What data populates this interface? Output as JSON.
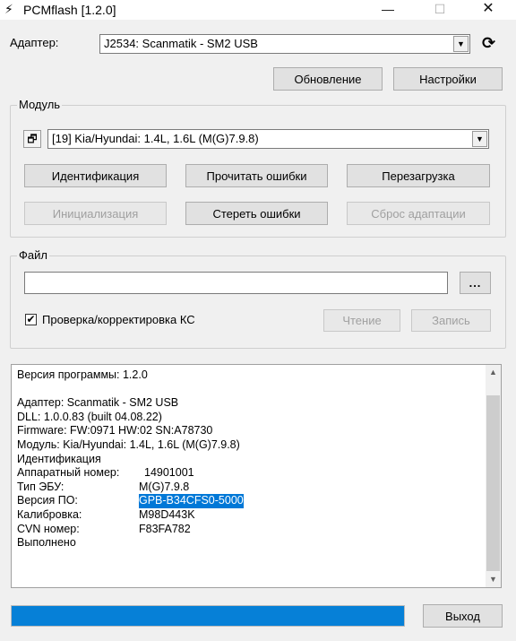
{
  "window": {
    "title": "PCMflash [1.2.0]",
    "minimize_glyph": "—",
    "maximize_glyph": "☐",
    "close_glyph": "✕"
  },
  "adapter": {
    "label": "Адаптер:",
    "selected": "J2534: Scanmatik - SM2 USB",
    "refresh_label": "Обновление",
    "settings_label": "Настройки"
  },
  "module_group": {
    "title": "Модуль",
    "selected": "[19] Kia/Hyundai: 1.4L, 1.6L (M(G)7.9.8)",
    "buttons": {
      "identify": "Идентификация",
      "read_errors": "Прочитать ошибки",
      "reboot": "Перезагрузка",
      "init": "Инициализация",
      "clear_errors": "Стереть ошибки",
      "reset_adaptation": "Сброс адаптации"
    }
  },
  "file_group": {
    "title": "Файл",
    "path_value": "",
    "browse_label": "...",
    "checksum_label": "Проверка/корректировка КС",
    "checksum_checked": true,
    "read_label": "Чтение",
    "write_label": "Запись"
  },
  "log": {
    "lines": [
      {
        "k": "Версия программы: 1.2.0",
        "v": ""
      },
      {
        "k": "",
        "v": ""
      },
      {
        "k": "Адаптер: Scanmatik - SM2 USB",
        "v": ""
      },
      {
        "k": "DLL: 1.0.0.83 (built 04.08.22)",
        "v": ""
      },
      {
        "k": "Firmware: FW:0971 HW:02 SN:A78730",
        "v": ""
      },
      {
        "k": "Модуль: Kia/Hyundai: 1.4L, 1.6L (M(G)7.9.8)",
        "v": ""
      },
      {
        "k": "Идентификация",
        "v": ""
      },
      {
        "k": "Аппаратный номер:",
        "v": "14901001"
      },
      {
        "k": "Тип ЭБУ:",
        "v": "M(G)7.9.8"
      },
      {
        "k": "Версия ПО:",
        "v": "GPB-B34CFS0-5000"
      },
      {
        "k": "Калибровка:",
        "v": "M98D443K"
      },
      {
        "k": "CVN номер:",
        "v": "F83FA782"
      },
      {
        "k": "Выполнено",
        "v": ""
      }
    ],
    "selected_index": 9
  },
  "progress": {
    "fraction": 1.0,
    "color": "#0680d7"
  },
  "exit_label": "Выход",
  "icons": {
    "app": "lightning-icon",
    "refresh": "refresh-icon",
    "module_window": "windows-icon",
    "dropdown": "chevron-down-icon"
  }
}
